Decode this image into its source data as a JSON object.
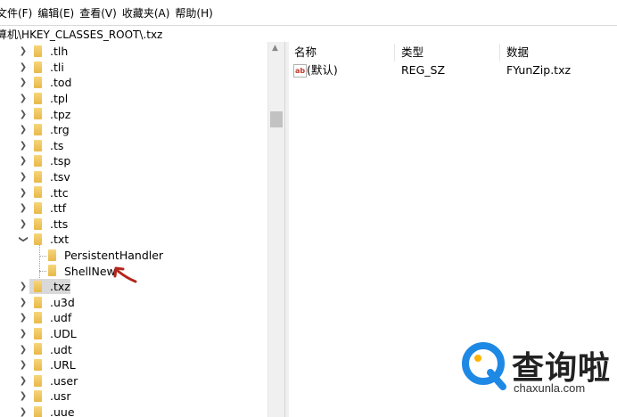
{
  "menu": [
    "文件(F)",
    "编辑(E)",
    "查看(V)",
    "收藏夹(A)",
    "帮助(H)"
  ],
  "address": "算机\\HKEY_CLASSES_ROOT\\.txz",
  "tree": {
    "items": [
      {
        "label": ".tlh"
      },
      {
        "label": ".tli"
      },
      {
        "label": ".tod"
      },
      {
        "label": ".tpl"
      },
      {
        "label": ".tpz"
      },
      {
        "label": ".trg"
      },
      {
        "label": ".ts"
      },
      {
        "label": ".tsp"
      },
      {
        "label": ".tsv"
      },
      {
        "label": ".ttc"
      },
      {
        "label": ".ttf"
      },
      {
        "label": ".tts"
      },
      {
        "label": ".txt"
      },
      {
        "label": "PersistentHandler"
      },
      {
        "label": "ShellNew"
      },
      {
        "label": ".txz"
      },
      {
        "label": ".u3d"
      },
      {
        "label": ".udf"
      },
      {
        "label": ".UDL"
      },
      {
        "label": ".udt"
      },
      {
        "label": ".URL"
      },
      {
        "label": ".user"
      },
      {
        "label": ".usr"
      },
      {
        "label": ".uue"
      }
    ]
  },
  "list": {
    "headers": {
      "name": "名称",
      "type": "类型",
      "data": "数据"
    },
    "rows": [
      {
        "name": "(默认)",
        "type": "REG_SZ",
        "data": "FYunZip.txz"
      }
    ]
  },
  "watermark": {
    "main": "查询啦",
    "sub": "chaxunla.com"
  },
  "colors": {
    "folder": "#e8b84a",
    "annotation_arrow": "#b3261e",
    "watermark_blue": "#1e88e5",
    "selection": "#d9d9d9"
  }
}
